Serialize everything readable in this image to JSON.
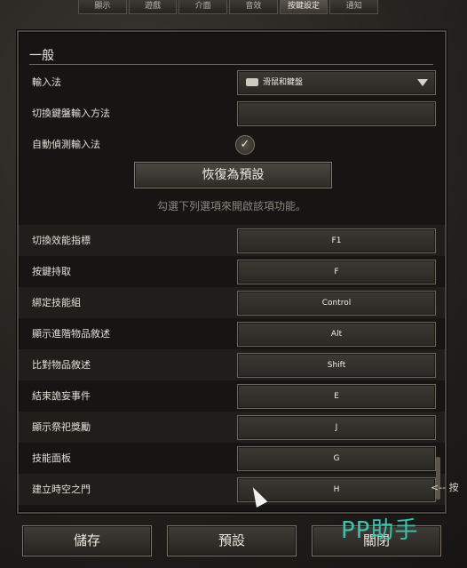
{
  "tabs": [
    "顯示",
    "遊戲",
    "介面",
    "音效",
    "按鍵設定",
    "通知"
  ],
  "section_title": "一般",
  "input_method": {
    "label": "輸入法",
    "value": "滑鼠和鍵盤"
  },
  "switch_keyboard": {
    "label": "切換鍵盤輸入方法",
    "value": ""
  },
  "auto_detect": {
    "label": "自動偵測輸入法",
    "checked": true
  },
  "reset_label": "恢復為預設",
  "hint": "勾選下列選項來開啟該項功能。",
  "bindings": [
    {
      "label": "切換效能指標",
      "key": "F1"
    },
    {
      "label": "按鍵持取",
      "key": "F"
    },
    {
      "label": "綁定技能組",
      "key": "Control"
    },
    {
      "label": "顯示進階物品敘述",
      "key": "Alt"
    },
    {
      "label": "比對物品敘述",
      "key": "Shift"
    },
    {
      "label": "結束詭妄事件",
      "key": "E"
    },
    {
      "label": "顯示祭祀獎勵",
      "key": "J"
    },
    {
      "label": "技能面板",
      "key": "G"
    },
    {
      "label": "建立時空之門",
      "key": "H"
    }
  ],
  "buttons": {
    "save": "儲存",
    "default": "預設",
    "close": "關閉"
  },
  "side_hint": "<-- 按",
  "watermark": "PP助手"
}
